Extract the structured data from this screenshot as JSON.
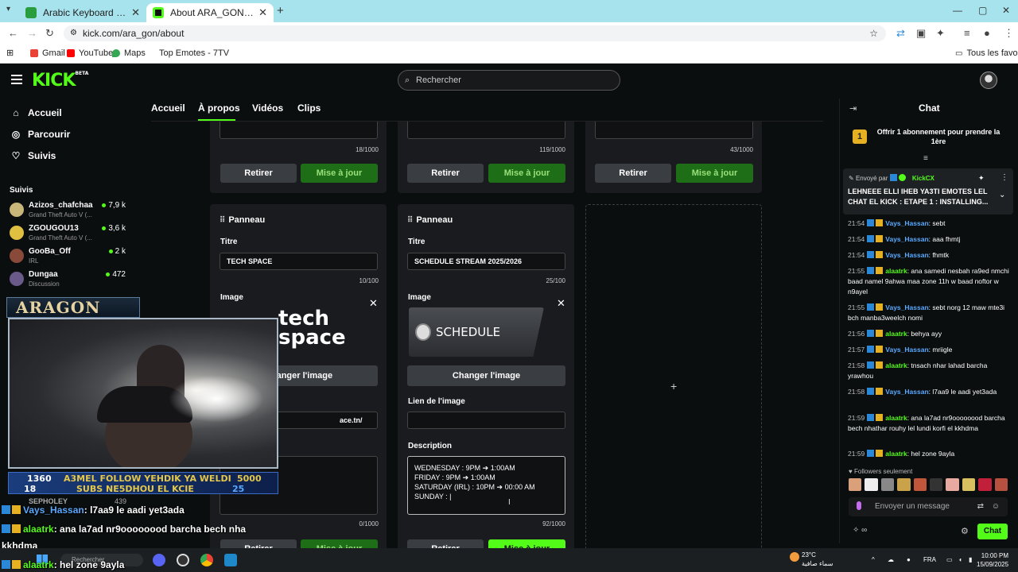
{
  "browser": {
    "tabs": [
      {
        "title": "Arabic Keyboard Online • Lexilo",
        "color": "#2a9d3e"
      },
      {
        "title": "About ARA_GON - Watch Live o",
        "color": "#53fc18"
      }
    ],
    "url": "kick.com/ara_gon/about",
    "bookmarks": [
      "Gmail",
      "YouTube",
      "Maps",
      "Top Emotes - 7TV"
    ],
    "all_bookmarks": "Tous les favoris"
  },
  "header": {
    "logo": "KICK",
    "logo_badge": "BETA",
    "search_placeholder": "Rechercher"
  },
  "sidebar": {
    "links": [
      "Accueil",
      "Parcourir",
      "Suivis"
    ],
    "followed_label": "Suivis",
    "channels": [
      {
        "name": "Azizos_chafchaa",
        "game": "Grand Theft Auto V (...",
        "viewers": "7,9 k"
      },
      {
        "name": "ZGOUGOU13",
        "game": "Grand Theft Auto V (...",
        "viewers": "3,6 k"
      },
      {
        "name": "GooBa_Off",
        "game": "IRL",
        "viewers": "2 k"
      },
      {
        "name": "Dungaa",
        "game": "Discussion",
        "viewers": "472"
      }
    ]
  },
  "channel_nav": {
    "tabs": [
      "Accueil",
      "À propos",
      "Vidéos",
      "Clips"
    ],
    "active": "À propos"
  },
  "panels": {
    "top_counts": [
      "18/1000",
      "119/1000",
      "43/1000"
    ],
    "remove_label": "Retirer",
    "update_label": "Mise à jour",
    "panel_label": "Panneau",
    "title_label": "Titre",
    "image_label": "Image",
    "change_image_label": "Changer l'image",
    "image_link_label": "Lien de l'image",
    "description_label": "Description",
    "panel1": {
      "title_value": "TECH SPACE",
      "title_count": "10/100",
      "image_text": "tech\nspace",
      "link_value": "ace.tn/",
      "desc_count": "0/1000"
    },
    "panel2": {
      "title_value": "SCHEDULE STREAM 2025/2026",
      "title_count": "25/100",
      "image_text": "SCHEDULE",
      "link_value": "",
      "desc_lines": [
        "WEDNESDAY : 9PM ➔ 1:00AM",
        "FRIDAY : 9PM ➔ 1:00AM",
        "SATURDAY (IRL) : 10PM ➔ 00:00 AM",
        "SUNDAY : |"
      ],
      "desc_count": "92/1000"
    }
  },
  "overlay": {
    "brand": "ARAGON",
    "goal_left": "1360",
    "goal_left2": "18",
    "goal_text1": "A3MEL FOLLOW YEHDIK YA WELDI",
    "goal_text2": "SUBS NE5DHOU EL KCIE",
    "goal_right": "5000",
    "goal_right2": "25",
    "chat_lines": [
      {
        "user": "Vays_Hassan",
        "text": ": l7aa9 le aadi yet3ada",
        "blue": true
      },
      {
        "user": "alaatrk",
        "text": ": ana la7ad nr9oooooood barcha bech nha",
        "blue": false
      },
      {
        "user": "",
        "text": "kkhdma",
        "blue": false
      },
      {
        "user": "alaatrk",
        "text": ": hel zone 9ayla",
        "blue": false
      }
    ],
    "sidebar_peek_name": "SEPHOLEY",
    "sidebar_peek_count": "439"
  },
  "chat": {
    "title": "Chat",
    "sub_offer": "Offrir 1 abonnement pour prendre la 1ère",
    "sub_rank": "1",
    "pinned_by_label": "Envoyé par",
    "pinned_by": "KickCX",
    "pinned_text": "LEHNEEE ELLI IHEB YA3TI EMOTES LEL CHAT EL KICK : ETAPE 1 : INSTALLING...",
    "messages": [
      {
        "time": "21:54",
        "user": "Vays_Hassan",
        "text": ": sebt",
        "color": "#5aa9ff"
      },
      {
        "time": "21:54",
        "user": "Vays_Hassan",
        "text": ": aaa fhmtj",
        "color": "#5aa9ff"
      },
      {
        "time": "21:54",
        "user": "Vays_Hassan",
        "text": ": fhmtk",
        "color": "#5aa9ff"
      },
      {
        "time": "21:55",
        "user": "alaatrk",
        "text": ": ana samedi nesbah ra9ed nmchi baad namel 9ahwa maa zone 11h w baad noftor w n9ayel",
        "color": "#53fc18"
      },
      {
        "time": "21:55",
        "user": "Vays_Hassan",
        "text": ": sebt norg 12 maw mte3i bch manba3weelch nomi",
        "color": "#5aa9ff"
      },
      {
        "time": "21:56",
        "user": "alaatrk",
        "text": ": behya ayy",
        "color": "#53fc18"
      },
      {
        "time": "21:57",
        "user": "Vays_Hassan",
        "text": ": mriigle",
        "color": "#5aa9ff"
      },
      {
        "time": "21:58",
        "user": "alaatrk",
        "text": ": tnsach nhar lahad barcha yrawhou",
        "color": "#53fc18"
      },
      {
        "time": "21:58",
        "user": "Vays_Hassan",
        "text": ": l7aa9 le aadi yet3ada",
        "color": "#5aa9ff"
      },
      {
        "time": "21:59",
        "user": "alaatrk",
        "text": ": ana la7ad nr9oooooood barcha bech nhathar rouhy lel lundi korfi el kkhdma",
        "color": "#53fc18"
      },
      {
        "time": "21:59",
        "user": "alaatrk",
        "text": ": hel zone 9ayla",
        "color": "#53fc18"
      }
    ],
    "followers_only": "Followers seulement",
    "input_placeholder": "Envoyer un message",
    "send_label": "Chat"
  },
  "taskbar": {
    "search_placeholder": "Rechercher",
    "weather_temp": "23°C",
    "weather_desc": "سماء صافية",
    "lang": "FRA",
    "time": "10:00 PM",
    "date": "15/09/2025"
  }
}
